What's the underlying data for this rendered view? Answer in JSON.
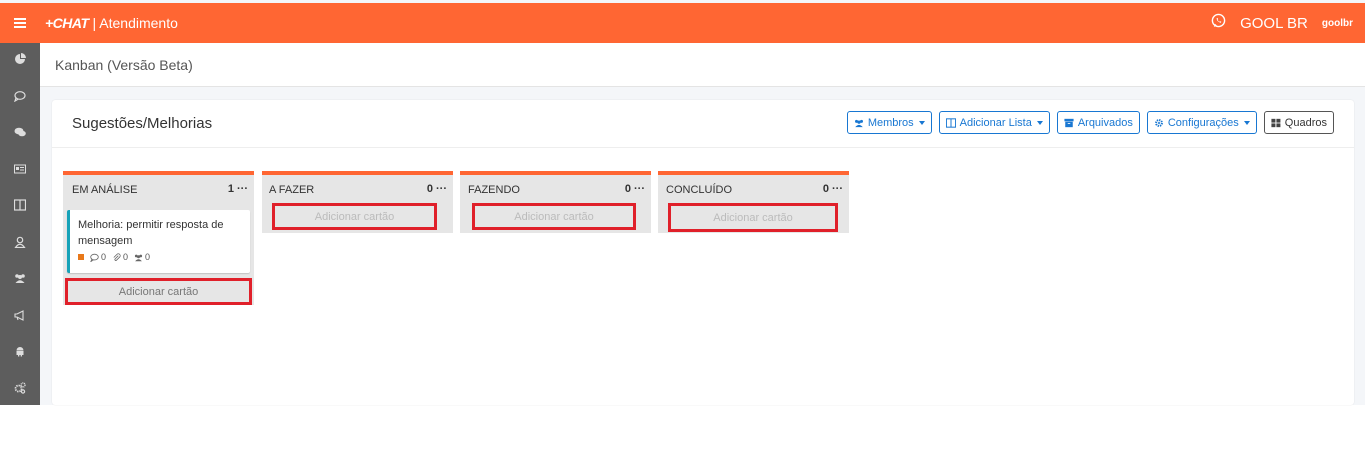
{
  "topbar": {
    "logo": "+CHAT",
    "section": "| Atendimento",
    "company": "GOOL BR",
    "user": "goolbr"
  },
  "sidebar": {
    "items": [
      {
        "icon": "pie-chart-icon"
      },
      {
        "icon": "speech-bubble-icon"
      },
      {
        "icon": "chat-bubbles-icon"
      },
      {
        "icon": "id-card-icon"
      },
      {
        "icon": "columns-icon"
      },
      {
        "icon": "user-icon"
      },
      {
        "icon": "users-icon"
      },
      {
        "icon": "bullhorn-icon"
      },
      {
        "icon": "android-icon"
      },
      {
        "icon": "cogs-icon"
      }
    ]
  },
  "header": {
    "title": "Kanban (Versão Beta)"
  },
  "board": {
    "title": "Sugestões/Melhorias",
    "toolbar": {
      "members": "Membros",
      "add_list": "Adicionar Lista",
      "archived": "Arquivados",
      "settings": "Configurações",
      "boards": "Quadros"
    },
    "lists": [
      {
        "name": "EM ANÁLISE",
        "count": "1",
        "cards": [
          {
            "text": "Melhoria: permitir resposta de mensagem",
            "comments": "0",
            "attachments": "0",
            "members": "0"
          }
        ],
        "add_label": "Adicionar cartão"
      },
      {
        "name": "A FAZER",
        "count": "0",
        "add_label": "Adicionar cartão"
      },
      {
        "name": "FAZENDO",
        "count": "0",
        "add_label": "Adicionar cartão"
      },
      {
        "name": "CONCLUÍDO",
        "count": "0",
        "add_label": "Adicionar cartão"
      }
    ]
  },
  "colors": {
    "accent": "#ff6633",
    "sidebar": "#5d5d5d",
    "primary": "#1877d2",
    "highlight": "#e0202a"
  }
}
